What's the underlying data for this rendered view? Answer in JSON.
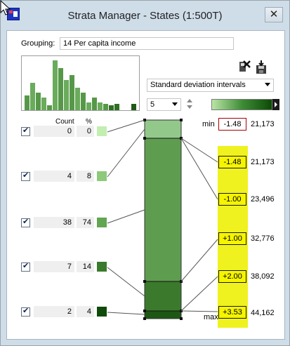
{
  "window": {
    "title": "Strata Manager - States (1:500T)",
    "close_label": "✕"
  },
  "grouping": {
    "label": "Grouping:",
    "value": "14 Per capita income"
  },
  "classification": {
    "method": "Standard deviation intervals",
    "class_count": "5"
  },
  "columns": {
    "count": "Count",
    "percent": "%"
  },
  "histogram_heights": [
    0.3,
    0.55,
    0.35,
    0.25,
    0.1,
    1.0,
    0.85,
    0.6,
    0.7,
    0.45,
    0.35,
    0.15,
    0.25,
    0.15,
    0.12,
    0.1,
    0.12
  ],
  "classes": [
    {
      "count": "0",
      "percent": "0",
      "color": "#c3eeb2",
      "checked": true
    },
    {
      "count": "4",
      "percent": "8",
      "color": "#8cc97a",
      "checked": true
    },
    {
      "count": "38",
      "percent": "74",
      "color": "#62a553",
      "checked": true
    },
    {
      "count": "7",
      "percent": "14",
      "color": "#3a7a2c",
      "checked": true
    },
    {
      "count": "2",
      "percent": "4",
      "color": "#0f4a0a",
      "checked": true
    }
  ],
  "breaks": {
    "min_label": "min",
    "max_label": "max",
    "min": {
      "sd": "-1.48",
      "value": "21,173"
    },
    "values": [
      {
        "sd": "-1.48",
        "value": "21,173"
      },
      {
        "sd": "-1.00",
        "value": "23,496"
      },
      {
        "sd": "+1.00",
        "value": "32,776"
      },
      {
        "sd": "+2.00",
        "value": "38,092"
      }
    ],
    "max": {
      "sd": "+3.53",
      "value": "44,162"
    }
  },
  "colors": {
    "accent_yellow": "#eff21e",
    "bar_green": "#5e9c50"
  }
}
